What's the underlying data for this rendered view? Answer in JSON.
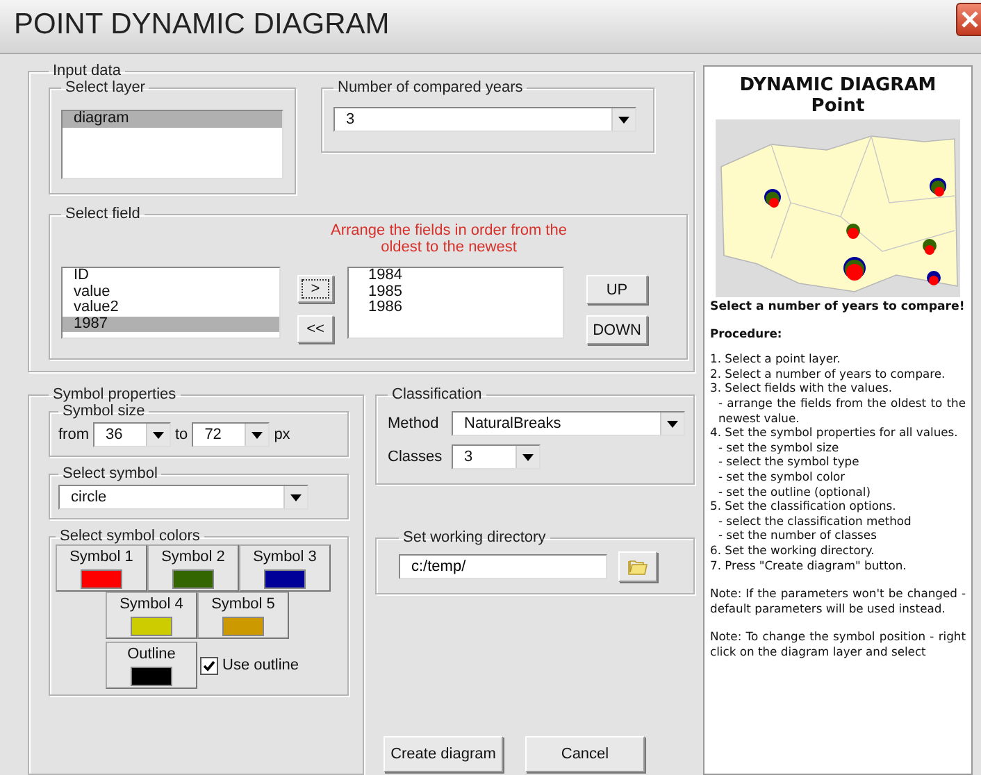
{
  "window": {
    "title": "POINT DYNAMIC DIAGRAM"
  },
  "input_data": {
    "label": "Input data",
    "select_layer": {
      "label": "Select layer",
      "items": [
        {
          "text": "diagram",
          "selected": true
        }
      ]
    },
    "compared_years": {
      "label": "Number of compared years",
      "value": "3"
    },
    "select_field": {
      "label": "Select field",
      "hint": "Arrange the fields in order from the oldest to the newest",
      "available": [
        {
          "text": "ID",
          "selected": false
        },
        {
          "text": "value",
          "selected": false
        },
        {
          "text": "value2",
          "selected": false
        },
        {
          "text": "1987",
          "selected": true
        }
      ],
      "add_button": ">",
      "remove_button": "<<",
      "chosen": [
        {
          "text": "1984",
          "selected": false
        },
        {
          "text": "1985",
          "selected": false
        },
        {
          "text": "1986",
          "selected": false
        }
      ],
      "up_button": "UP",
      "down_button": "DOWN"
    }
  },
  "symbol_properties": {
    "label": "Symbol properties",
    "size": {
      "label": "Symbol size",
      "from_label": "from",
      "from": "36",
      "to_label": "to",
      "to": "72",
      "unit": "px"
    },
    "symbol": {
      "label": "Select symbol",
      "value": "circle"
    },
    "colors": {
      "label": "Select symbol colors",
      "swatches": [
        {
          "label": "Symbol 1",
          "color": "#ff0000"
        },
        {
          "label": "Symbol 2",
          "color": "#336600"
        },
        {
          "label": "Symbol 3",
          "color": "#000099"
        },
        {
          "label": "Symbol 4",
          "color": "#cccc00"
        },
        {
          "label": "Symbol 5",
          "color": "#cc9900"
        }
      ],
      "outline": {
        "label": "Outline",
        "color": "#000000"
      },
      "use_outline": {
        "label": "Use outline",
        "checked": true
      }
    }
  },
  "classification": {
    "label": "Classification",
    "method_label": "Method",
    "method": "NaturalBreaks",
    "classes_label": "Classes",
    "classes": "3"
  },
  "directory": {
    "label": "Set working directory",
    "value": "c:/temp/"
  },
  "buttons": [
    "Create diagram",
    "Cancel"
  ],
  "help": {
    "title": "DYNAMIC DIAGRAM",
    "subtitle": "Point",
    "caption": "Select a number of years to compare!",
    "procedure_label": "Procedure:",
    "steps": [
      {
        "text": "1. Select a point layer."
      },
      {
        "text": "2. Select a number of years to compare."
      },
      {
        "text": "3. Select fields with the values.",
        "children": [
          {
            "text": "- arrange the fields from the oldest to the newest value."
          }
        ]
      },
      {
        "text": "4. Set the symbol properties for all values.",
        "children": [
          {
            "text": "- set the symbol size"
          },
          {
            "text": "- select the symbol type"
          },
          {
            "text": "- set the symbol color"
          },
          {
            "text": "- set the outline (optional)"
          }
        ]
      },
      {
        "text": "5. Set the classification options.",
        "children": [
          {
            "text": "- select the classification method"
          },
          {
            "text": "- set the number of classes"
          }
        ]
      },
      {
        "text": "6. Set the working directory."
      },
      {
        "text": "7. Press \"Create diagram\" button."
      }
    ],
    "notes": [
      "Note: If the parameters won't be changed - default parameters will be used instead.",
      "Note: To change the symbol position - right click on the diagram layer and select"
    ]
  }
}
